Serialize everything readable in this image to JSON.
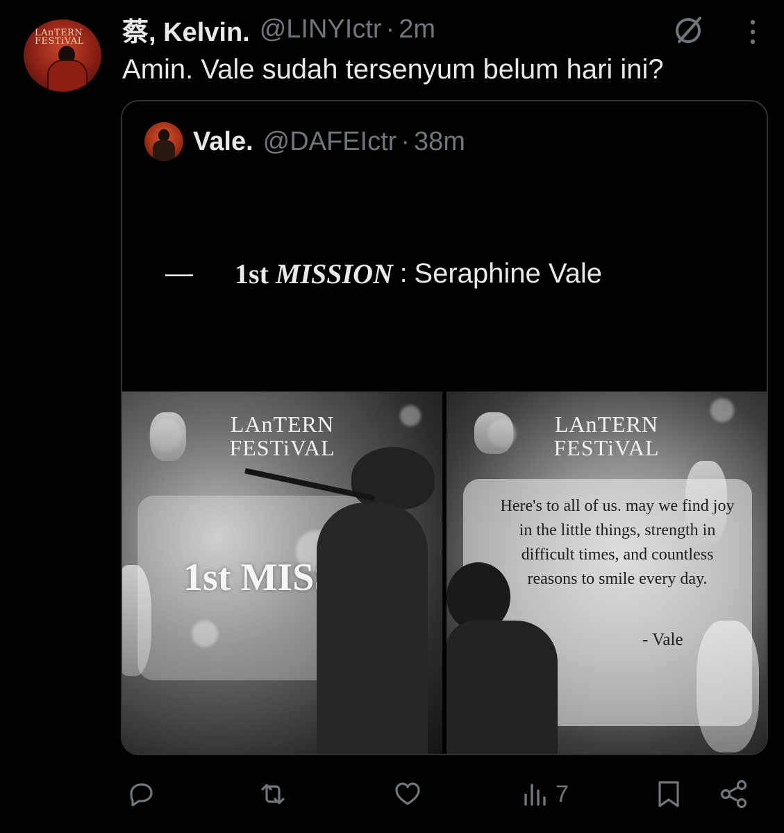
{
  "tweet": {
    "display_name": "蔡, Kelvin.",
    "handle": "@LINYIctr",
    "separator": "·",
    "time": "2m",
    "text": "Amin. Vale sudah tersenyum belum hari ini?",
    "avatar_icon": "user-avatar-icon",
    "avatar_logo": "LAnTERN FESTiVAL"
  },
  "quoted": {
    "display_name": "Vale.",
    "handle": "@DAFEIctr",
    "separator": "·",
    "time": "38m",
    "dash": "—",
    "mission_ordinal": "1st",
    "mission_word": "MISSION",
    "mission_sep": ":",
    "mission_subject": "Seraphine Vale",
    "images": {
      "left": {
        "logo_line1": "LAnTERN",
        "logo_line2": "FESTiVAL",
        "overlay": "1st MISSION"
      },
      "right": {
        "logo_line1": "LAnTERN",
        "logo_line2": "FESTiVAL",
        "quote": "Here's to all of us. may we find joy in the little things, strength in difficult times, and countless reasons to smile every day.",
        "signature": "- Vale"
      }
    }
  },
  "actions": {
    "reply_icon": "reply-icon",
    "retweet_icon": "retweet-icon",
    "like_icon": "heart-icon",
    "views_icon": "views-icon",
    "views_count": "7",
    "bookmark_icon": "bookmark-icon",
    "share_icon": "share-icon"
  },
  "colors": {
    "background": "#000000",
    "text_primary": "#e7e9ea",
    "text_secondary": "#71767b",
    "border": "#2f3336"
  }
}
